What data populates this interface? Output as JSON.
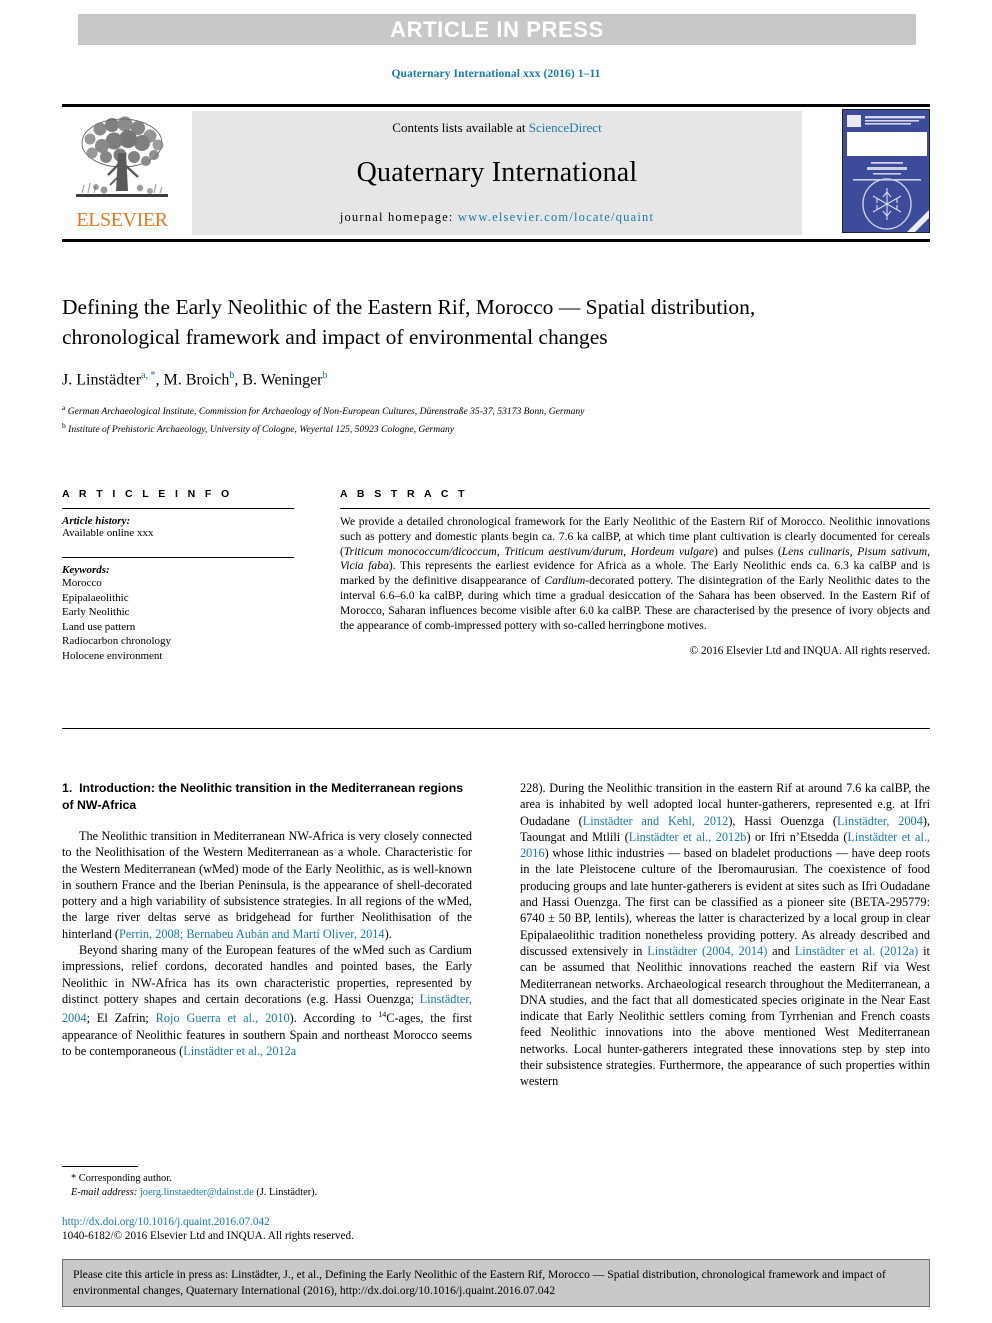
{
  "banner": {
    "text": "ARTICLE IN PRESS"
  },
  "running_head": "Quaternary International xxx (2016) 1–11",
  "masthead": {
    "contents_prefix": "Contents lists available at ",
    "sciencedirect": "ScienceDirect",
    "journal_title": "Quaternary International",
    "homepage_label": "journal homepage: ",
    "homepage_url": "www.elsevier.com/locate/quaint",
    "publisher_name": "ELSEVIER",
    "publisher_color": "#e87722",
    "link_color": "#1a7aa8",
    "cover_alt": "QUATERNARY INTERNATIONAL"
  },
  "article": {
    "title": "Defining the Early Neolithic of the Eastern Rif, Morocco — Spatial distribution, chronological framework and impact of environmental changes",
    "authors": [
      {
        "name": "J. Linstädter",
        "marks": "a, *"
      },
      {
        "name": "M. Broich",
        "marks": "b"
      },
      {
        "name": "B. Weninger",
        "marks": "b"
      }
    ],
    "authors_plain": "J. Linstädter a, *, M. Broich b, B. Weninger b",
    "affiliations": [
      {
        "mark": "a",
        "text": "German Archaeological Institute, Commission for Archaeology of Non-European Cultures, Dürenstraße 35-37, 53173 Bonn, Germany"
      },
      {
        "mark": "b",
        "text": "Institute of Prehistoric Archaeology, University of Cologne, Weyertal 125, 50923 Cologne, Germany"
      }
    ]
  },
  "article_info": {
    "heading": "A R T I C L E  I N F O",
    "history_label": "Article history:",
    "history_value": "Available online xxx",
    "keywords_label": "Keywords:",
    "keywords": [
      "Morocco",
      "Epipalaeolithic",
      "Early Neolithic",
      "Land use pattern",
      "Radiocarbon chronology",
      "Holocene environment"
    ]
  },
  "abstract": {
    "heading": "A B S T R A C T",
    "p1_a": "We provide a detailed chronological framework for the Early Neolithic of the Eastern Rif of Morocco. Neolithic innovations such as pottery and domestic plants begin ca. 7.6 ka calBP, at which time plant cultivation is clearly documented for cereals (",
    "p1_i1": "Triticum monococcum/dicoccum, Triticum aestivum/durum, Hordeum vulgare",
    "p1_b": ") and pulses (",
    "p1_i2": "Lens culinaris, Pisum sativum, Vicia faba",
    "p1_c": "). This represents the earliest evidence for Africa as a whole. The Early Neolithic ends ca. 6.3 ka calBP and is marked by the definitive disappearance of ",
    "p1_i3": "Cardium",
    "p1_d": "-decorated pottery. The disintegration of the Early Neolithic dates to the interval 6.6–6.0 ka calBP, during which time a gradual desiccation of the Sahara has been observed. In the Eastern Rif of Morocco, Saharan influences become visible after 6.0 ka calBP. These are characterised by the presence of ivory objects and the appearance of comb-impressed pottery with so-called herringbone motives.",
    "copyright": "© 2016 Elsevier Ltd and INQUA. All rights reserved."
  },
  "body": {
    "section_number": "1.",
    "section_title": "Introduction: the Neolithic transition in the Mediterranean regions of NW-Africa",
    "left_p1_a": "The Neolithic transition in Mediterranean NW-Africa is very closely connected to the Neolithisation of the Western Mediterranean as a whole. Characteristic for the Western Mediterranean (wMed) mode of the Early Neolithic, as is well-known in southern France and the Iberian Peninsula, is the appearance of shell-decorated pottery and a high variability of subsistence strategies. In all regions of the wMed, the large river deltas serve as bridgehead for further Neolithisation of the hinterland (",
    "left_p1_ref1": "Perrin, 2008; Bernabeu Aubán and Martí Oliver, 2014",
    "left_p1_b": ").",
    "left_p2_a": "Beyond sharing many of the European features of the wMed such as Cardium impressions, relief cordons, decorated handles and pointed bases, the Early Neolithic in NW-Africa has its own characteristic properties, represented by distinct pottery shapes and certain decorations (e.g. Hassi Ouenzga; ",
    "left_p2_ref1": "Linstädter, 2004",
    "left_p2_b": "; El Zafrin; ",
    "left_p2_ref2": "Rojo Guerra et al., 2010",
    "left_p2_c": "). According to ",
    "left_p2_sup": "14",
    "left_p2_d": "C-ages, the first appearance of Neolithic features in southern Spain and northeast Morocco seems to be contemporaneous (",
    "left_p2_ref3": "Linstädter et al., 2012a",
    "right_p1_a": "228). During the Neolithic transition in the eastern Rif at around 7.6 ka calBP, the area is inhabited by well adopted local hunter-gatherers, represented e.g. at Ifri Oudadane (",
    "right_p1_ref1": "Linstädter and Kehl, 2012",
    "right_p1_b": "), Hassi Ouenzga (",
    "right_p1_ref2": "Linstädter, 2004",
    "right_p1_c": "), Taoungat and Mtlili (",
    "right_p1_ref3": "Linstädter et al., 2012b",
    "right_p1_d": ") or Ifri n’Etsedda (",
    "right_p1_ref4": "Linstädter et al., 2016",
    "right_p1_e": ") whose lithic industries — based on bladelet productions — have deep roots in the late Pleistocene culture of the Iberomaurusian. The coexistence of food producing groups and late hunter-gatherers is evident at sites such as Ifri Oudadane and Hassi Ouenzga. The first can be classified as a pioneer site (BETA-295779: 6740 ± 50 BP, lentils), whereas the latter is characterized by a local group in clear Epipalaeolithic tradition nonetheless providing pottery. As already described and discussed extensively in ",
    "right_p1_ref5": "Linstädter (2004, 2014)",
    "right_p1_f": " and ",
    "right_p1_ref6": "Linstädter et al. (2012a)",
    "right_p1_g": " it can be assumed that Neolithic innovations reached the eastern Rif via West Mediterranean networks. Archaeological research throughout the Mediterranean, a DNA studies, and the fact that all domesticated species originate in the Near East indicate that Early Neolithic settlers coming from Tyrrhenian and French coasts feed Neolithic innovations into the above mentioned West Mediterranean networks. Local hunter-gatherers integrated these innovations step by step into their subsistence strategies. Furthermore, the appearance of such properties within western"
  },
  "footnotes": {
    "corresponding": "* Corresponding author.",
    "email_label": "E-mail address:",
    "email": "joerg.linstaedter@dainst.de",
    "email_suffix": "(J. Linstädter).",
    "doi": "http://dx.doi.org/10.1016/j.quaint.2016.07.042",
    "issn": "1040-6182/© 2016 Elsevier Ltd and INQUA. All rights reserved."
  },
  "cite_box": {
    "text": "Please cite this article in press as: Linstädter, J., et al., Defining the Early Neolithic of the Eastern Rif, Morocco — Spatial distribution, chronological framework and impact of environmental changes, Quaternary International (2016), http://dx.doi.org/10.1016/j.quaint.2016.07.042"
  }
}
